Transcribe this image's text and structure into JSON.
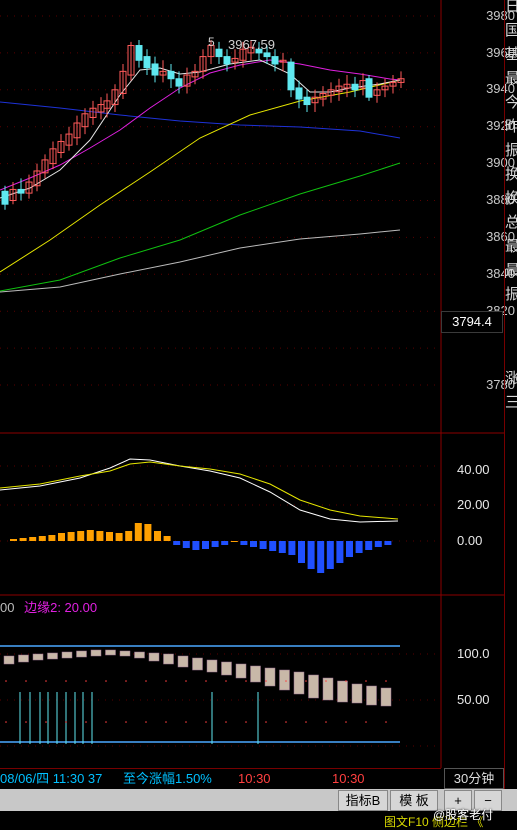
{
  "colors": {
    "background": "#000000",
    "border": "#8b0000",
    "bull_candle": "#ff5a5a",
    "bear_candle": "#5fe8f0",
    "ma_white": "#e6e6e6",
    "ma_yellow": "#e6e600",
    "ma_magenta": "#e020e0",
    "ma_green": "#10c010",
    "ma_blue": "#1e32d8",
    "ma_gray": "#bbbbbb",
    "macd_dif": "#ffffff",
    "macd_dea": "#e6e600",
    "bar_pos": "#ffa000",
    "bar_neg": "#2050ff",
    "edge_line": "#4aa8ff",
    "legend_magenta": "#e020e0",
    "status_date": "#00c0ff",
    "status_rise": "#ff4040",
    "time_label": "#ff4040"
  },
  "main_chart": {
    "price_labels": [
      "3980",
      "3960",
      "3940",
      "3920",
      "3900",
      "3880",
      "3860",
      "3840",
      "3820",
      "3780"
    ],
    "high_marker": "3967.59",
    "current_price": "3794.4"
  },
  "indicator_chart": {
    "labels": [
      "40.00",
      "20.00",
      "0.00"
    ]
  },
  "third_chart": {
    "legend_left": "00",
    "legend_label": "边缘2: 20.00",
    "labels": [
      "100.0",
      "50.00"
    ]
  },
  "status_bar": {
    "date_info": "08/06/四 11:30 37",
    "since_label": "至今涨幅1.50%",
    "time1": "10:30",
    "time2": "10:30",
    "period": "30分钟"
  },
  "toolbar": {
    "indicator_btn": "指标B",
    "template_btn": "模 板",
    "plus_btn": "+",
    "minus_btn": "−"
  },
  "right_panel": {
    "chars": [
      "日",
      "国",
      "基",
      "最",
      "今",
      "昨",
      "振",
      "换",
      "换",
      "总",
      "最",
      "最",
      "振"
    ],
    "lower_chars": [
      "涨",
      "三"
    ]
  },
  "bottom": {
    "partial_text": "图文F10 侧边栏 《",
    "watermark": "@股客老付"
  }
}
